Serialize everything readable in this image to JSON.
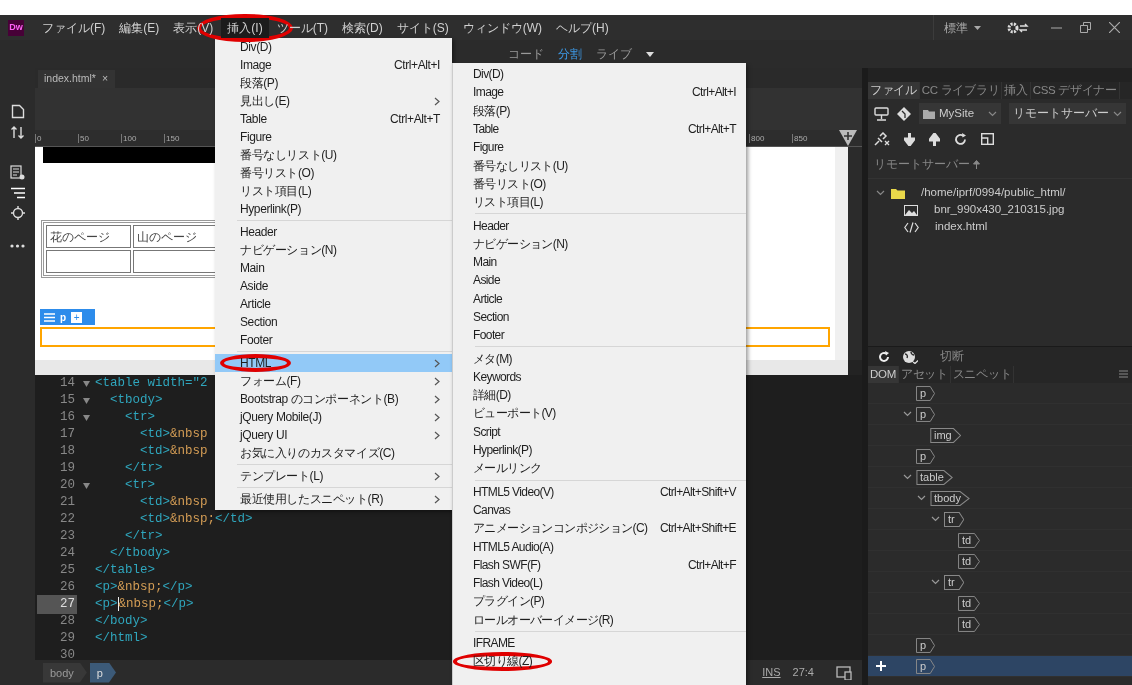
{
  "app": {
    "logo": "Dw"
  },
  "menubar": [
    {
      "label": "ファイル(F)",
      "selected": false
    },
    {
      "label": "編集(E)",
      "selected": false
    },
    {
      "label": "表示(V)",
      "selected": false
    },
    {
      "label": "挿入(I)",
      "selected": true,
      "circled": true
    },
    {
      "label": "ツール(T)",
      "selected": false
    },
    {
      "label": "検索(D)",
      "selected": false
    },
    {
      "label": "サイト(S)",
      "selected": false
    },
    {
      "label": "ウィンドウ(W)",
      "selected": false
    },
    {
      "label": "ヘルプ(H)",
      "selected": false
    }
  ],
  "workspace": {
    "label": "標準"
  },
  "view_switcher": [
    {
      "label": "コード",
      "selected": false
    },
    {
      "label": "分割",
      "selected": true
    },
    {
      "label": "ライブ",
      "selected": false
    }
  ],
  "document_tab": {
    "label": "index.html*",
    "close": "×"
  },
  "ruler": {
    "left_ticks": [
      "0",
      "50",
      "100",
      "150"
    ],
    "right_ticks": [
      "800",
      "850"
    ]
  },
  "design_view": {
    "table_rows": [
      {
        "cells": [
          {
            "text": "花のページ"
          },
          {
            "text": "山のページ"
          }
        ]
      },
      {
        "cells": [
          {},
          {}
        ]
      }
    ],
    "tag_badge": "p",
    "add": "+"
  },
  "code": {
    "lines": [
      {
        "number": "14",
        "fold": true,
        "parts": [
          {
            "kind": "tag",
            "text": "<table width=\"2"
          }
        ]
      },
      {
        "number": "15",
        "fold": true,
        "parts": [
          {
            "kind": "tag",
            "text": "  <tbody>"
          }
        ]
      },
      {
        "number": "16",
        "fold": true,
        "parts": [
          {
            "kind": "tag",
            "text": "    <tr>"
          }
        ]
      },
      {
        "number": "17",
        "parts": [
          {
            "kind": "tag",
            "text": "      <td>"
          },
          {
            "kind": "entity",
            "text": "&nbsp"
          }
        ]
      },
      {
        "number": "18",
        "parts": [
          {
            "kind": "tag",
            "text": "      <td>"
          },
          {
            "kind": "entity",
            "text": "&nbsp"
          }
        ]
      },
      {
        "number": "19",
        "parts": [
          {
            "kind": "tag",
            "text": "    </tr>"
          }
        ]
      },
      {
        "number": "20",
        "fold": true,
        "parts": [
          {
            "kind": "tag",
            "text": "    <tr>"
          }
        ]
      },
      {
        "number": "21",
        "parts": [
          {
            "kind": "tag",
            "text": "      <td>"
          },
          {
            "kind": "entity",
            "text": "&nbsp"
          }
        ]
      },
      {
        "number": "22",
        "parts": [
          {
            "kind": "tag",
            "text": "      <td>"
          },
          {
            "kind": "entity",
            "text": "&nbsp;"
          },
          {
            "kind": "tag",
            "text": "</td>"
          }
        ]
      },
      {
        "number": "23",
        "parts": [
          {
            "kind": "tag",
            "text": "    </tr>"
          }
        ]
      },
      {
        "number": "24",
        "parts": [
          {
            "kind": "tag",
            "text": "  </tbody>"
          }
        ]
      },
      {
        "number": "25",
        "parts": [
          {
            "kind": "tag",
            "text": "</table>"
          }
        ]
      },
      {
        "number": "26",
        "parts": [
          {
            "kind": "tag",
            "text": "<p>"
          },
          {
            "kind": "entity",
            "text": "&nbsp;"
          },
          {
            "kind": "tag",
            "text": "</p>"
          }
        ]
      },
      {
        "number": "27",
        "current": true,
        "parts": [
          {
            "kind": "tag",
            "text": "<p>"
          },
          {
            "kind": "entity",
            "text": "&nbsp;"
          },
          {
            "kind": "tag",
            "text": "</p>"
          }
        ]
      },
      {
        "number": "28",
        "parts": [
          {
            "kind": "tag",
            "text": "</body>"
          }
        ]
      },
      {
        "number": "29",
        "parts": [
          {
            "kind": "tag",
            "text": "</html>"
          }
        ]
      },
      {
        "number": "30"
      }
    ]
  },
  "status_bar": {
    "breadcrumbs": [
      {
        "label": "body",
        "selected": false
      },
      {
        "label": "p",
        "selected": true
      }
    ],
    "mode": "INS",
    "position": "27:4"
  },
  "files_panel": {
    "tabs": [
      {
        "label": "ファイル",
        "selected": true
      },
      {
        "label": "CC ライブラリ",
        "selected": false
      },
      {
        "label": "挿入",
        "selected": false
      },
      {
        "label": "CSS デザイナー",
        "selected": false
      }
    ],
    "site": "MySite",
    "server": "リモートサーバー",
    "column_header": "リモートサーバー",
    "tree": [
      {
        "name": "/home/iprf/0994/public_html/",
        "kind": "folder",
        "expanded": true,
        "children": [
          {
            "name": "bnr_990x430_210315.jpg",
            "kind": "image"
          },
          {
            "name": "index.html",
            "kind": "code"
          }
        ]
      }
    ]
  },
  "connection": {
    "label": "切断"
  },
  "dom_panel": {
    "tabs": [
      {
        "label": "DOM",
        "selected": true
      },
      {
        "label": "アセット",
        "selected": false
      },
      {
        "label": "スニペット",
        "selected": false
      }
    ],
    "tree": [
      {
        "tag": "p",
        "selected": false
      },
      {
        "tag": "p",
        "selected": false,
        "expanded": true,
        "children": [
          {
            "tag": "img",
            "selected": false
          }
        ]
      },
      {
        "tag": "p",
        "selected": false
      },
      {
        "tag": "table",
        "selected": false,
        "expanded": true,
        "children": [
          {
            "tag": "tbody",
            "selected": false,
            "expanded": true,
            "children": [
              {
                "tag": "tr",
                "selected": false,
                "expanded": true,
                "children": [
                  {
                    "tag": "td",
                    "selected": false
                  },
                  {
                    "tag": "td",
                    "selected": false
                  }
                ]
              },
              {
                "tag": "tr",
                "selected": false,
                "expanded": true,
                "children": [
                  {
                    "tag": "td",
                    "selected": false
                  },
                  {
                    "tag": "td",
                    "selected": false
                  }
                ]
              }
            ]
          }
        ]
      },
      {
        "tag": "p",
        "selected": false
      },
      {
        "tag": "p",
        "selected": true
      }
    ]
  },
  "insert_menu": {
    "sections": [
      [
        {
          "label": "Div(D)",
          "selected": false
        },
        {
          "label": "Image",
          "shortcut": "Ctrl+Alt+I",
          "selected": false
        },
        {
          "label": "段落(P)",
          "selected": false
        },
        {
          "label": "見出し(E)",
          "submenu": true,
          "selected": false
        },
        {
          "label": "Table",
          "shortcut": "Ctrl+Alt+T",
          "selected": false
        },
        {
          "label": "Figure",
          "selected": false
        },
        {
          "label": "番号なしリスト(U)",
          "selected": false
        },
        {
          "label": "番号リスト(O)",
          "selected": false
        },
        {
          "label": "リスト項目(L)",
          "selected": false
        },
        {
          "label": "Hyperlink(P)",
          "selected": false
        }
      ],
      [
        {
          "label": "Header",
          "selected": false
        },
        {
          "label": "ナビゲーション(N)",
          "selected": false
        },
        {
          "label": "Main",
          "selected": false
        },
        {
          "label": "Aside",
          "selected": false
        },
        {
          "label": "Article",
          "selected": false
        },
        {
          "label": "Section",
          "selected": false
        },
        {
          "label": "Footer",
          "selected": false
        }
      ],
      [
        {
          "label": "HTML",
          "submenu": true,
          "selected": true,
          "circled": true
        },
        {
          "label": "フォーム(F)",
          "submenu": true,
          "selected": false
        },
        {
          "label": "Bootstrap のコンポーネント(B)",
          "submenu": true,
          "selected": false
        },
        {
          "label": "jQuery Mobile(J)",
          "submenu": true,
          "selected": false
        },
        {
          "label": "jQuery UI",
          "submenu": true,
          "selected": false
        },
        {
          "label": "お気に入りのカスタマイズ(C)",
          "selected": false
        }
      ],
      [
        {
          "label": "テンプレート(L)",
          "submenu": true,
          "selected": false
        }
      ],
      [
        {
          "label": "最近使用したスニペット(R)",
          "submenu": true,
          "selected": false
        }
      ]
    ]
  },
  "html_submenu": {
    "sections": [
      [
        {
          "label": "Div(D)",
          "selected": false
        },
        {
          "label": "Image",
          "shortcut": "Ctrl+Alt+I",
          "selected": false
        },
        {
          "label": "段落(P)",
          "selected": false
        },
        {
          "label": "Table",
          "shortcut": "Ctrl+Alt+T",
          "selected": false
        },
        {
          "label": "Figure",
          "selected": false
        },
        {
          "label": "番号なしリスト(U)",
          "selected": false
        },
        {
          "label": "番号リスト(O)",
          "selected": false
        },
        {
          "label": "リスト項目(L)",
          "selected": false
        }
      ],
      [
        {
          "label": "Header",
          "selected": false
        },
        {
          "label": "ナビゲーション(N)",
          "selected": false
        },
        {
          "label": "Main",
          "selected": false
        },
        {
          "label": "Aside",
          "selected": false
        },
        {
          "label": "Article",
          "selected": false
        },
        {
          "label": "Section",
          "selected": false
        },
        {
          "label": "Footer",
          "selected": false
        }
      ],
      [
        {
          "label": "メタ(M)",
          "selected": false
        },
        {
          "label": "Keywords",
          "selected": false
        },
        {
          "label": "詳細(D)",
          "selected": false
        },
        {
          "label": "ビューポート(V)",
          "selected": false
        },
        {
          "label": "Script",
          "selected": false
        },
        {
          "label": "Hyperlink(P)",
          "selected": false
        },
        {
          "label": "メールリンク",
          "selected": false
        }
      ],
      [
        {
          "label": "HTML5 Video(V)",
          "shortcut": "Ctrl+Alt+Shift+V",
          "selected": false
        },
        {
          "label": "Canvas",
          "selected": false
        },
        {
          "label": "アニメーションコンポジション(C)",
          "shortcut": "Ctrl+Alt+Shift+E",
          "selected": false
        },
        {
          "label": "HTML5 Audio(A)",
          "selected": false
        },
        {
          "label": "Flash SWF(F)",
          "shortcut": "Ctrl+Alt+F",
          "selected": false
        },
        {
          "label": "Flash Video(L)",
          "selected": false
        },
        {
          "label": "プラグイン(P)",
          "selected": false
        },
        {
          "label": "ロールオーバーイメージ(R)",
          "selected": false
        }
      ],
      [
        {
          "label": "IFRAME",
          "selected": false
        },
        {
          "label": "区切り線(Z)",
          "selected": false,
          "circled": true
        }
      ]
    ]
  }
}
